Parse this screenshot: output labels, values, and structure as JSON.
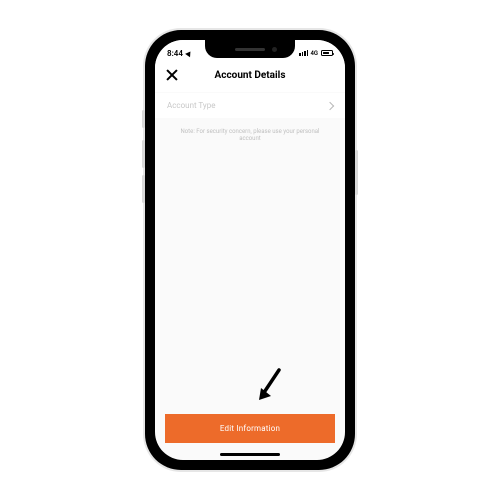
{
  "status_bar": {
    "time": "8:44",
    "network": "4G"
  },
  "header": {
    "title": "Account Details"
  },
  "form": {
    "account_type": {
      "label": "Account Type"
    },
    "note": "Note: For security concern, please use your personal account"
  },
  "actions": {
    "edit": "Edit Information"
  },
  "colors": {
    "primary": "#ed6b2a"
  }
}
